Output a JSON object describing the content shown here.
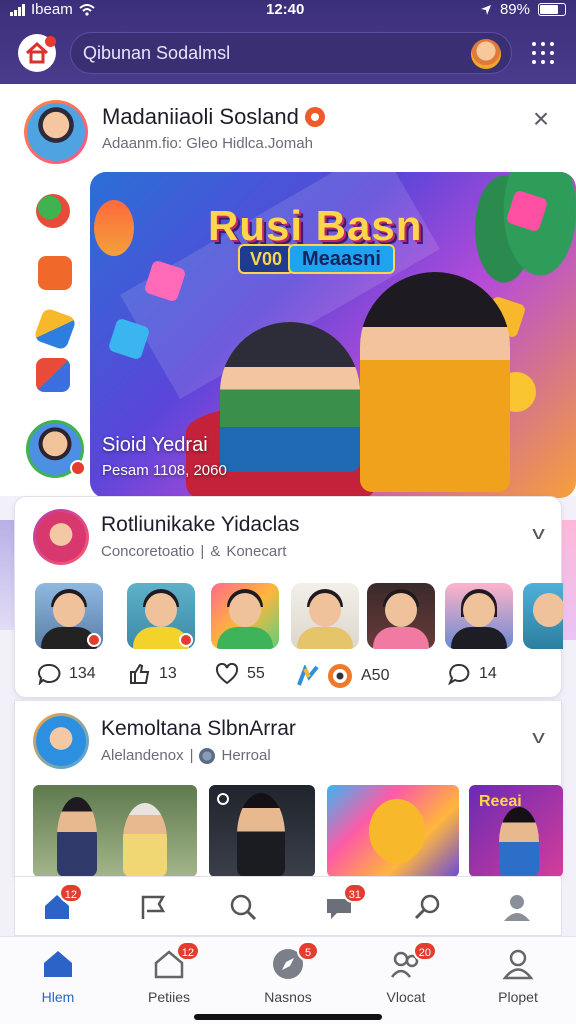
{
  "status_bar": {
    "carrier": "Ibeam",
    "time": "12:40",
    "battery": "89%"
  },
  "header": {
    "search_placeholder": "Qibunan Sodalmsl"
  },
  "profile": {
    "name": "Madaniiaoli Sosland",
    "subtitle": "Adaanm.fio: Gleo Hidlca.Jomah"
  },
  "hero": {
    "title": "Rusi Basn",
    "tag_left": "V00",
    "tag_right": "Meaasni",
    "caption": "Sioid Yedrai",
    "caption_sub": "Pesam 1108, 2060"
  },
  "card1": {
    "title": "Rotliunikake Yidaclas",
    "subtitle": "Concoretoatio",
    "subtitle_suffix": "Konecart",
    "actions": [
      {
        "icon": "comment-icon",
        "count": "134"
      },
      {
        "icon": "thumbs-up-icon",
        "count": "13"
      },
      {
        "icon": "heart-icon",
        "count": "55"
      },
      {
        "icon": "reaction-emoji-icon",
        "count": "A50"
      },
      {
        "icon": "message-icon",
        "count": "14"
      }
    ]
  },
  "card2": {
    "title": "Kemoltana SlbnArrar",
    "subtitle": "Alelandenox",
    "subtitle_suffix": "Herroal",
    "photo_label": "Reeai"
  },
  "tabstrip": {
    "badges": {
      "home": "12",
      "chat": "31"
    }
  },
  "navbar": {
    "items": [
      {
        "label": "Hlem",
        "badge": ""
      },
      {
        "label": "Petiies",
        "badge": "12"
      },
      {
        "label": "Nasnos",
        "badge": "5"
      },
      {
        "label": "Vlocat",
        "badge": "20"
      },
      {
        "label": "Plopet",
        "badge": ""
      }
    ]
  },
  "colors": {
    "header": "#3c2f7a",
    "accent_blue": "#2c63c7",
    "badge_red": "#e43d30"
  }
}
